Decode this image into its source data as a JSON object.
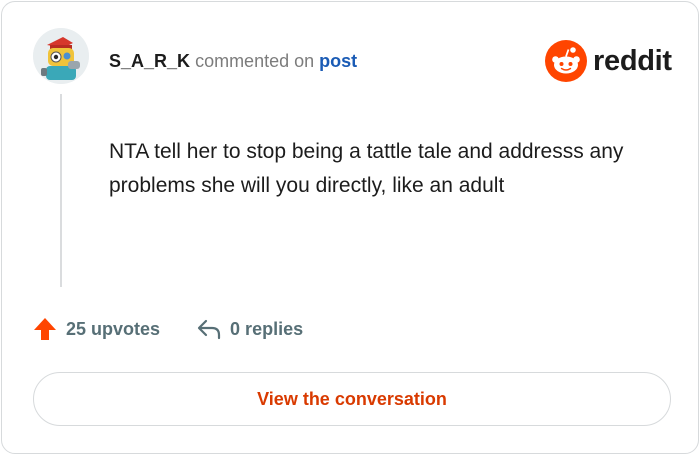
{
  "comment": {
    "username": "S_A_R_K",
    "action_text": "commented on",
    "target": "post",
    "body": "NTA tell her to stop being a tattle tale and addresss any problems she will you directly, like an adult"
  },
  "brand": {
    "name": "reddit",
    "color": "#ff4500"
  },
  "stats": {
    "upvotes": "25 upvotes",
    "replies": "0 replies"
  },
  "icons": {
    "avatar": "robot-avatar",
    "upvote": "upvote-arrow-icon",
    "reply": "reply-arrow-icon",
    "logo": "reddit-alien-icon"
  },
  "cta": {
    "label": "View the conversation"
  },
  "colors": {
    "accent": "#d93a00",
    "link": "#1a5bb5",
    "muted": "#576f76",
    "upvote": "#ff4500"
  }
}
